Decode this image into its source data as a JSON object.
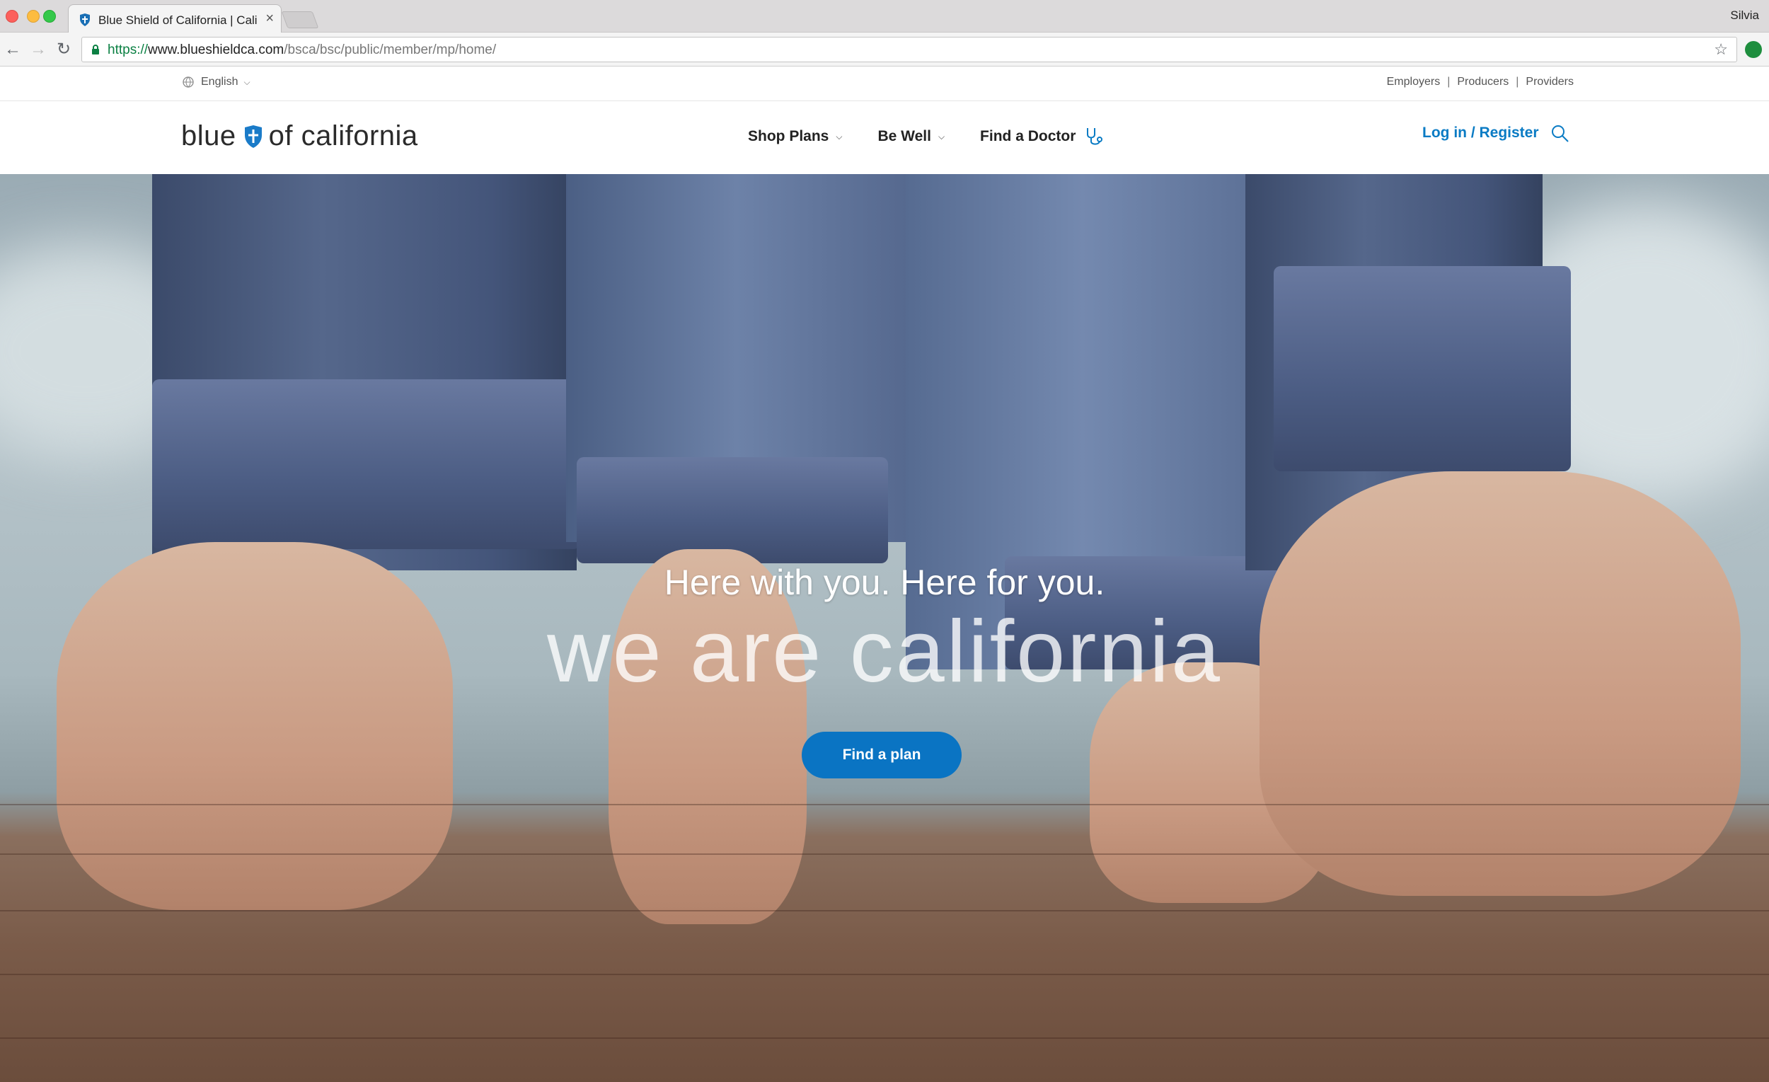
{
  "browser": {
    "tab_title": "Blue Shield of California | Cali",
    "profile_name": "Silvia",
    "url_scheme": "https://",
    "url_host": "www.blueshieldca.com",
    "url_path": "/bsca/bsc/public/member/mp/home/"
  },
  "utility": {
    "language": "English",
    "links": [
      "Employers",
      "Producers",
      "Providers"
    ]
  },
  "header": {
    "logo_left": "blue",
    "logo_right": "of california",
    "nav": [
      {
        "label": "Shop Plans",
        "has_dropdown": true
      },
      {
        "label": "Be Well",
        "has_dropdown": true
      },
      {
        "label": "Find a Doctor",
        "icon": "stethoscope-icon"
      }
    ],
    "login_label": "Log in / Register"
  },
  "hero": {
    "title": "Here with you. Here for you.",
    "script": "we are california",
    "cta_label": "Find a plan"
  },
  "colors": {
    "brand_blue": "#0a7bc4",
    "cta_blue": "#0a74c3"
  }
}
